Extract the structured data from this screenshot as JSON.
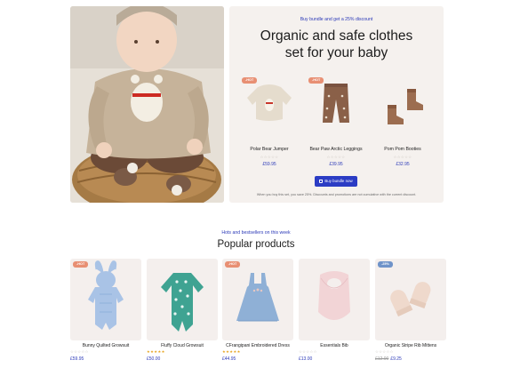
{
  "bundle": {
    "promo": "Buy bundle and get a 25% discount",
    "title_line1": "Organic and safe clothes",
    "title_line2": "set for your baby",
    "items": [
      {
        "badge": "-HOT",
        "name": "Polar Bear Jumper",
        "stars": "☆☆☆☆☆",
        "price": "£59.95",
        "icon": "jumper-icon"
      },
      {
        "badge": "-HOT",
        "name": "Bear Paw Arctic Leggings",
        "stars": "☆☆☆☆☆",
        "price": "£39.95",
        "icon": "leggings-icon"
      },
      {
        "name": "Pom Pom Booties",
        "stars": "☆☆☆☆☆",
        "price": "£32.95",
        "icon": "booties-icon"
      }
    ],
    "button_label": "Buy bundle now",
    "note": "When you buy this set, you save 25%. Discounts and promotions are not cumulative with the current discount."
  },
  "popular": {
    "kicker": "Hots and bestsellers on this week",
    "title": "Popular products",
    "products": [
      {
        "badge": "-HOT",
        "badge_color": "#e88f73",
        "name": "Bunny Quilted Growsuit",
        "stars": "☆☆☆☆☆",
        "rated": false,
        "price": "£59.95",
        "old_price": "",
        "icon": "bunny-growsuit-icon"
      },
      {
        "badge": "",
        "name": "Fluffy Cloud Growsuit",
        "stars": "★★★★★",
        "rated": true,
        "price": "£50.00",
        "old_price": "",
        "icon": "cloud-growsuit-icon"
      },
      {
        "badge": "-HOT",
        "badge_color": "#e88f73",
        "name": "CFrangipani Embroidered Dress",
        "stars": "★★★★★",
        "rated": true,
        "price": "£44.95",
        "old_price": "",
        "icon": "dress-icon"
      },
      {
        "badge": "",
        "name": "Essentials Bib",
        "stars": "☆☆☆☆☆",
        "rated": false,
        "price": "£13.00",
        "old_price": "",
        "icon": "bib-icon"
      },
      {
        "badge": "-25%",
        "badge_color": "#6f93c9",
        "name": "Organic Stripe Rib Mittens",
        "stars": "☆☆☆☆☆",
        "rated": false,
        "price": "£9.25",
        "old_price": "£12.00",
        "icon": "mittens-icon"
      }
    ]
  },
  "colors": {
    "accent": "#2b3cc4",
    "hot_badge": "#e88f73",
    "sale_badge": "#6f93c9",
    "panel": "#f5f1ee"
  }
}
